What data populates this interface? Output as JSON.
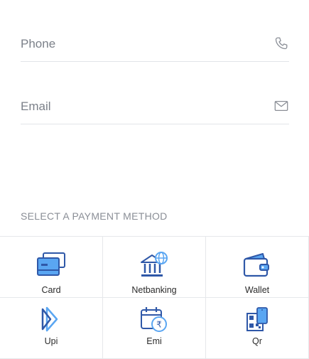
{
  "form": {
    "phone": {
      "placeholder": "Phone",
      "icon": "phone-icon"
    },
    "email": {
      "placeholder": "Email",
      "icon": "mail-icon"
    }
  },
  "payment": {
    "title": "SELECT A PAYMENT METHOD",
    "methods": [
      {
        "label": "Card",
        "icon": "card-icon"
      },
      {
        "label": "Netbanking",
        "icon": "bank-icon"
      },
      {
        "label": "Wallet",
        "icon": "wallet-icon"
      },
      {
        "label": "Upi",
        "icon": "upi-icon"
      },
      {
        "label": "Emi",
        "icon": "emi-calendar-icon"
      },
      {
        "label": "Qr",
        "icon": "qr-icon"
      }
    ]
  },
  "colors": {
    "icon_dark": "#2f58a8",
    "icon_light": "#5aa6f2",
    "text_muted": "#7b8089",
    "divider": "#e2e4e8"
  }
}
